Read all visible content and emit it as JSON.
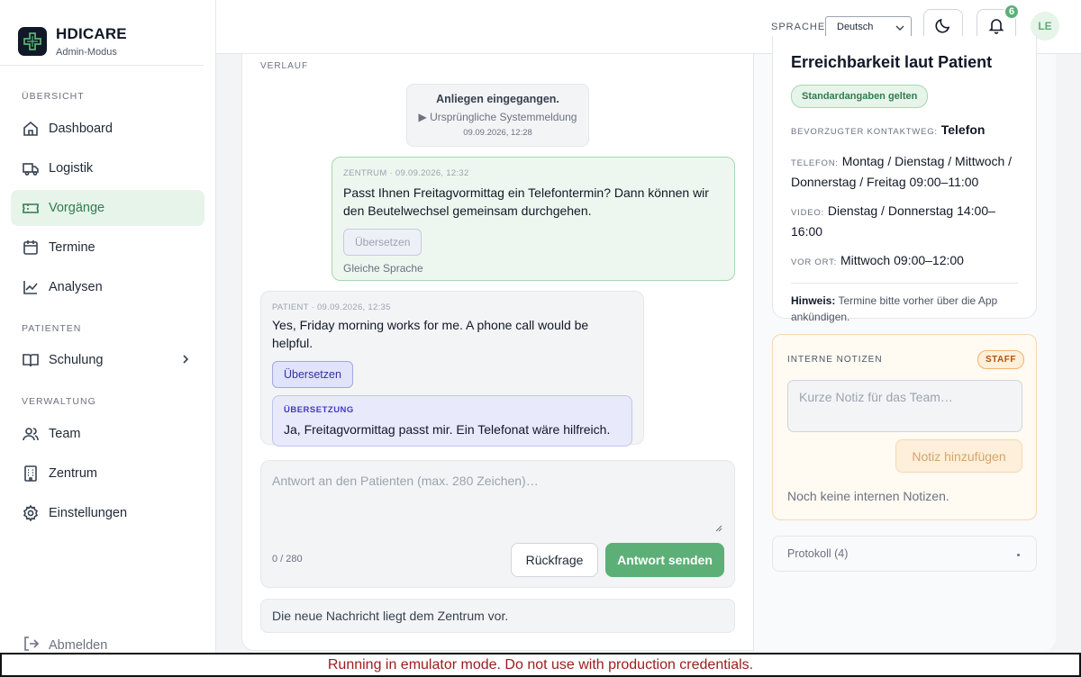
{
  "brand": {
    "title": "HDICARE",
    "subtitle": "Admin-Modus"
  },
  "nav": {
    "section_overview": "ÜBERSICHT",
    "section_patients": "PATIENTEN",
    "section_admin": "VERWALTUNG",
    "items": [
      {
        "label": "Dashboard",
        "icon": "home-icon"
      },
      {
        "label": "Logistik",
        "icon": "truck-icon"
      },
      {
        "label": "Vorgänge",
        "icon": "ticket-icon",
        "active": true
      },
      {
        "label": "Termine",
        "icon": "calendar-icon"
      },
      {
        "label": "Analysen",
        "icon": "chart-line-icon"
      },
      {
        "label": "Schulung",
        "icon": "book-icon"
      },
      {
        "label": "Team",
        "icon": "users-icon"
      },
      {
        "label": "Zentrum",
        "icon": "building-icon"
      },
      {
        "label": "Einstellungen",
        "icon": "gear-icon"
      }
    ],
    "logout": "Abmelden"
  },
  "topbar": {
    "language_label": "SPRACHE",
    "language_value": "Deutsch",
    "notification_count": "6",
    "avatar_initials": "LE"
  },
  "conversation": {
    "section_label": "VERLAUF",
    "system": {
      "title": "Anliegen eingegangen.",
      "link": "▶ Ursprüngliche Systemmeldung",
      "time": "09.09.2026, 12:28"
    },
    "center_message": {
      "meta": "ZENTRUM · 09.09.2026, 12:32",
      "text": "Passt Ihnen Freitagvormittag ein Telefontermin? Dann können wir den Beutelwechsel gemeinsam durchgehen.",
      "translate_label": "Übersetzen",
      "note": "Gleiche Sprache"
    },
    "patient_message": {
      "meta": "PATIENT · 09.09.2026, 12:35",
      "text": "Yes, Friday morning works for me. A phone call would be helpful.",
      "translate_label": "Übersetzen",
      "translation_label": "ÜBERSETZUNG",
      "translation_text": "Ja, Freitagvormittag passt mir. Ein Telefonat wäre hilfreich."
    },
    "reply": {
      "placeholder": "Antwort an den Patienten (max. 280 Zeichen)…",
      "counter": "0 / 280",
      "query_button": "Rückfrage",
      "send_button": "Antwort senden"
    },
    "status": "Die neue Nachricht liegt dem Zentrum vor."
  },
  "reachability": {
    "title": "Erreichbarkeit laut Patient",
    "badge": "Standardangaben gelten",
    "preferred_key": "BEVORZUGTER KONTAKTWEG:",
    "preferred_value": "Telefon",
    "phone_key": "TELEFON:",
    "phone_value": "Montag / Dienstag / Mittwoch / Donnerstag / Freitag 09:00–11:00",
    "video_key": "VIDEO:",
    "video_value": "Dienstag / Donnerstag 14:00–16:00",
    "onsite_key": "VOR ORT:",
    "onsite_value": "Mittwoch 09:00–12:00",
    "hint_key": "Hinweis:",
    "hint_value": "Termine bitte vorher über die App ankündigen."
  },
  "notes": {
    "label": "INTERNE NOTIZEN",
    "badge": "STAFF",
    "placeholder": "Kurze Notiz für das Team…",
    "add_button": "Notiz hinzufügen",
    "empty": "Noch keine internen Notizen."
  },
  "protocol": {
    "label": "Protokoll (4)"
  },
  "emulator_banner": "Running in emulator mode. Do not use with production credentials.",
  "colors": {
    "accent": "#5cb077",
    "active_bg": "#e6f4ea",
    "translate": "#3730a3",
    "staff": "#b45309"
  }
}
